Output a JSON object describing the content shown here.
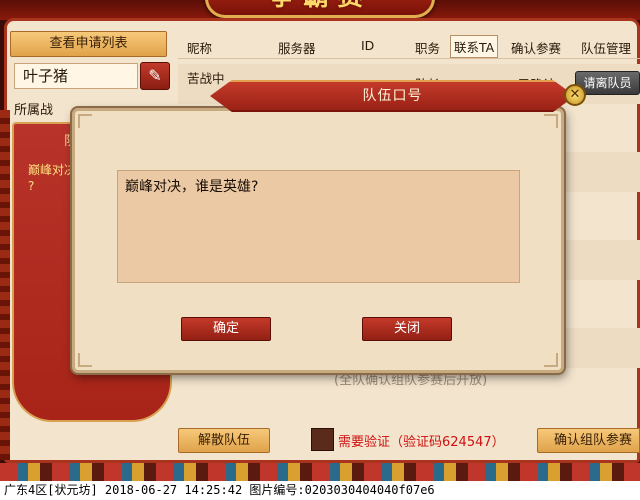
{
  "header": {
    "game_title": "争霸赛"
  },
  "left_panel": {
    "view_applications_label": "查看申请列表",
    "player_name": "叶子猪",
    "edit_icon": "pencil-icon",
    "section_label": "所属战",
    "card_tab_label": "队",
    "card_text_line1": "巅峰对决",
    "card_text_line2": "?"
  },
  "table": {
    "columns": [
      "昵称",
      "服务器",
      "ID",
      "职务",
      "联系TA",
      "确认参赛",
      "队伍管理"
    ],
    "active_column": "联系TA",
    "row1": {
      "name": "苦战中",
      "role": "队长",
      "status": "已确认"
    },
    "leave_team_label": "请离队员",
    "hint": "(全队确认组队参赛后开放)"
  },
  "actions": {
    "disband_label": "解散队伍",
    "verify_label": "需要验证（验证码624547）",
    "confirm_team_label": "确认组队参赛"
  },
  "modal": {
    "title": "队伍口号",
    "slogan_text": "巅峰对决，谁是英雄?",
    "ok_label": "确定",
    "close_label": "关闭",
    "close_icon": "close-x-icon"
  },
  "footer": {
    "status_line": "广东4区[状元坊] 2018-06-27 14:25:42 图片编号:0203030404040f07e6"
  },
  "colors": {
    "accent_red": "#a82418",
    "button_gold": "#e0a24a",
    "panel_bg": "#f3e4cd",
    "verify_red": "#d01010"
  }
}
